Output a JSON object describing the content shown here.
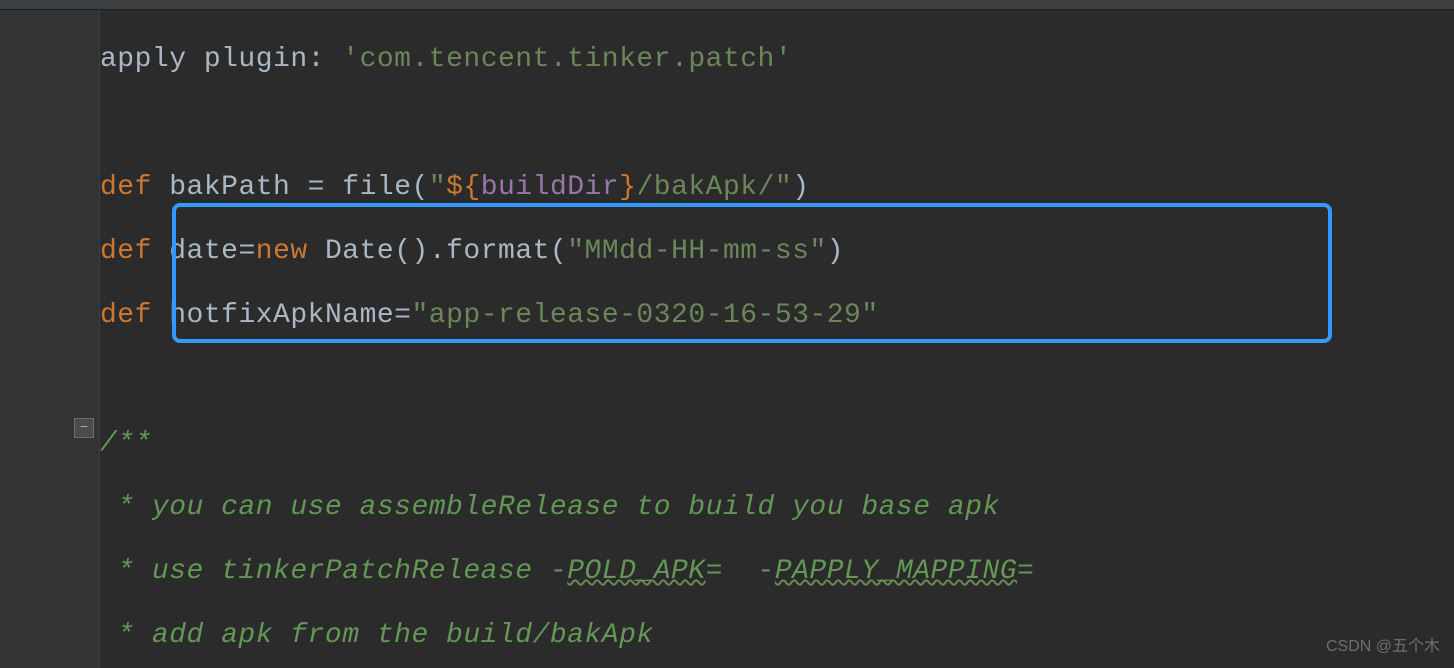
{
  "code": {
    "line1": {
      "apply": "apply",
      "plugin": "plugin:",
      "value": "'com.tencent.tinker.patch'"
    },
    "line3": {
      "def": "def",
      "var": "bakPath",
      "eq": "=",
      "fn": "file(",
      "q1": "\"",
      "interp_open": "${",
      "interp_var": "buildDir",
      "interp_close": "}",
      "rest": "/bakApk/",
      "q2": "\"",
      "close": ")"
    },
    "line4": {
      "def": "def",
      "var": "date",
      "eq": "=",
      "new": "new",
      "call": "Date().format(",
      "str": "\"MMdd-HH-mm-ss\"",
      "close": ")"
    },
    "line5": {
      "def": "def",
      "var": "hotfixApkName",
      "eq": "=",
      "str": "\"app-release-0320-16-53-29\""
    },
    "comment": {
      "open": "/**",
      "l1_pre": " * you can use assembleRelease to build you base apk",
      "l2_pre": " * use tinkerPatchRelease -",
      "l2_u1": "POLD_APK",
      "l2_mid": "=  -",
      "l2_u2": "PAPPLY_MAPPING",
      "l2_end": "=  ",
      "l3": " * add apk from the build/bakApk"
    }
  },
  "watermark": "CSDN @五个木"
}
